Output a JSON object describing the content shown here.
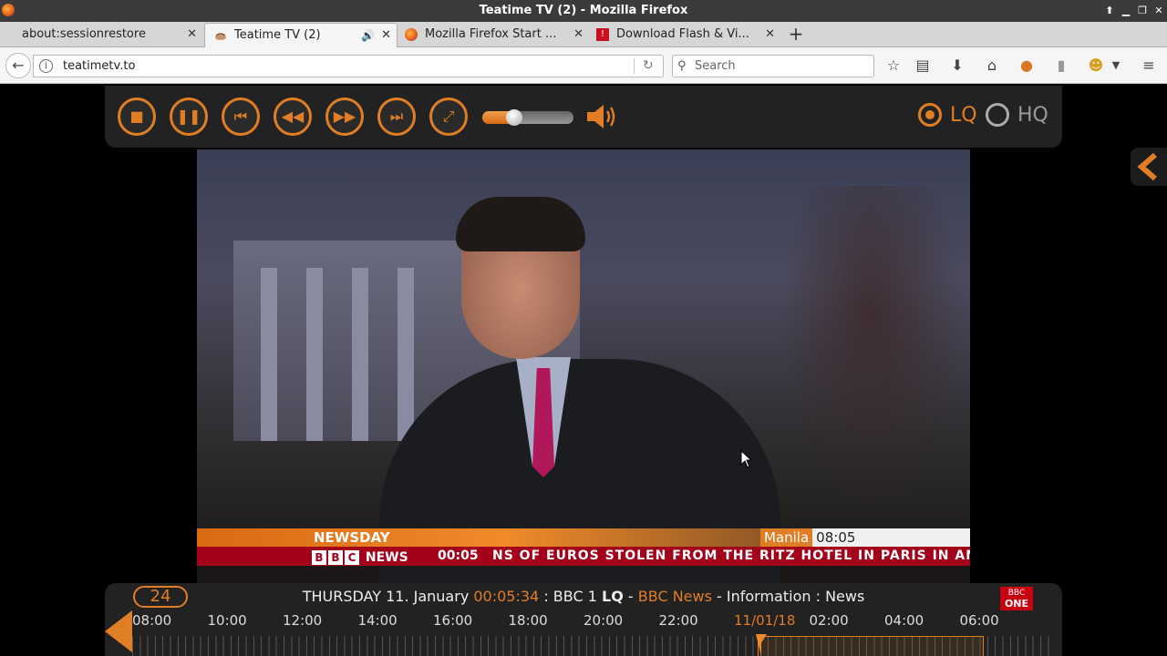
{
  "window": {
    "title": "Teatime TV (2) - Mozilla Firefox"
  },
  "tabs": [
    {
      "label": "about:sessionrestore",
      "active": false
    },
    {
      "label": "Teatime TV (2)",
      "active": true
    },
    {
      "label": "Mozilla Firefox Start ...",
      "active": false
    },
    {
      "label": "Download Flash & Vi...",
      "active": false
    }
  ],
  "navbar": {
    "url": "teatimetv.to",
    "search_placeholder": "Search"
  },
  "player": {
    "volume_fraction": 0.35,
    "quality_options": [
      {
        "label": "LQ",
        "selected": true
      },
      {
        "label": "HQ",
        "selected": false
      }
    ]
  },
  "video": {
    "show_label": "NEWSDAY",
    "location_city": "Manila",
    "location_time": "08:05",
    "channel_brand": "NEWS",
    "ticker_time": "00:05",
    "ticker_headline": "NS OF EUROS STOLEN FROM THE RITZ HOTEL IN PARIS IN AN"
  },
  "epg": {
    "channel_badge": "24",
    "day": "THURSDAY 11. January",
    "time": "00:05:34",
    "channel": ": BBC 1",
    "quality": "LQ",
    "dash1": " - ",
    "program": "BBC News",
    "rest": " - Information : News",
    "logo_line1": "BBC",
    "logo_line2": "ONE",
    "timeline": [
      "08:00",
      "10:00",
      "12:00",
      "14:00",
      "16:00",
      "18:00",
      "20:00",
      "22:00",
      "11/01/18",
      "02:00",
      "04:00",
      "06:00"
    ]
  },
  "colors": {
    "accent": "#e07e25",
    "bbc_red": "#a3001a"
  }
}
